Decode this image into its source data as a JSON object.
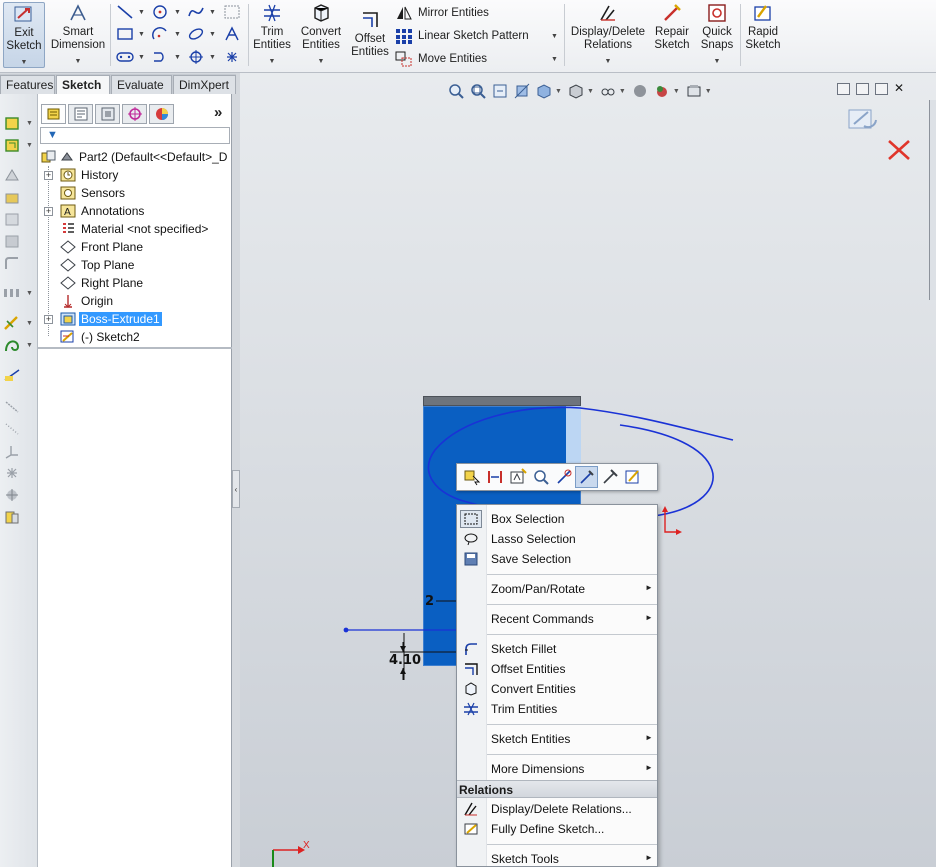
{
  "ribbon": {
    "exit_sketch": "Exit Sketch",
    "smart_dimension": "Smart Dimension",
    "trim_entities": "Trim Entities",
    "convert_entities": "Convert Entities",
    "offset_entities": "Offset Entities",
    "mirror_entities": "Mirror Entities",
    "linear_sketch_pattern": "Linear Sketch Pattern",
    "move_entities": "Move Entities",
    "display_delete_relations": "Display/Delete Relations",
    "repair_sketch": "Repair Sketch",
    "quick_snaps": "Quick Snaps",
    "rapid_sketch": "Rapid Sketch",
    "icons": [
      "line-icon",
      "circle-icon",
      "spline-icon",
      "rectangle-icon",
      "arc-icon",
      "ellipse-icon",
      "slot-icon",
      "polygon-icon",
      "point-icon",
      "text-icon",
      "construction-icon"
    ]
  },
  "tabs": [
    "Features",
    "Sketch",
    "Evaluate",
    "DimXpert"
  ],
  "active_tab": "Sketch",
  "feature_tree": {
    "root": "Part2  (Default<<Default>_D",
    "items": [
      {
        "label": "History",
        "icon": "history-icon",
        "expandable": true
      },
      {
        "label": "Sensors",
        "icon": "sensors-icon",
        "expandable": false
      },
      {
        "label": "Annotations",
        "icon": "annotations-icon",
        "expandable": true
      },
      {
        "label": "Material <not specified>",
        "icon": "material-icon",
        "expandable": false
      },
      {
        "label": "Front Plane",
        "icon": "plane-icon",
        "expandable": false
      },
      {
        "label": "Top Plane",
        "icon": "plane-icon",
        "expandable": false
      },
      {
        "label": "Right Plane",
        "icon": "plane-icon",
        "expandable": false
      },
      {
        "label": "Origin",
        "icon": "origin-icon",
        "expandable": false
      },
      {
        "label": "Boss-Extrude1",
        "icon": "extrude-icon",
        "expandable": true,
        "selected": true
      },
      {
        "label": "(-) Sketch2",
        "icon": "sketch-icon",
        "expandable": false
      }
    ],
    "more_label": "»"
  },
  "dimensions": {
    "d1": "2",
    "d2": "4.10"
  },
  "context_menu": {
    "items": [
      {
        "label": "Box Selection",
        "icon": "box-selection-icon",
        "submenu": false
      },
      {
        "label": "Lasso Selection",
        "icon": "lasso-icon",
        "submenu": false
      },
      {
        "label": "Save Selection",
        "icon": "save-selection-icon",
        "submenu": false
      },
      {
        "label": "Zoom/Pan/Rotate",
        "submenu": true
      },
      {
        "label": "Recent Commands",
        "submenu": true
      },
      {
        "label": "Sketch Fillet",
        "icon": "sketch-fillet-icon",
        "submenu": false
      },
      {
        "label": "Offset Entities",
        "icon": "offset-icon",
        "submenu": false
      },
      {
        "label": "Convert Entities",
        "icon": "convert-icon",
        "submenu": false
      },
      {
        "label": "Trim Entities",
        "icon": "trim-icon",
        "submenu": false
      },
      {
        "label": "Sketch Entities",
        "submenu": true
      },
      {
        "label": "More Dimensions",
        "submenu": true
      }
    ],
    "relations_header": "Relations",
    "relations_items": [
      {
        "label": "Display/Delete Relations...",
        "icon": "relations-icon"
      },
      {
        "label": "Fully Define Sketch...",
        "icon": "fully-define-icon"
      }
    ],
    "tools_item": {
      "label": "Sketch Tools",
      "submenu": true
    }
  },
  "axis": {
    "x": "X"
  },
  "colors": {
    "part_face": "#0a5fc2",
    "selection": "#3399ff",
    "sketch_stroke": "#1a32d6",
    "confirm_red": "#e0352b"
  }
}
